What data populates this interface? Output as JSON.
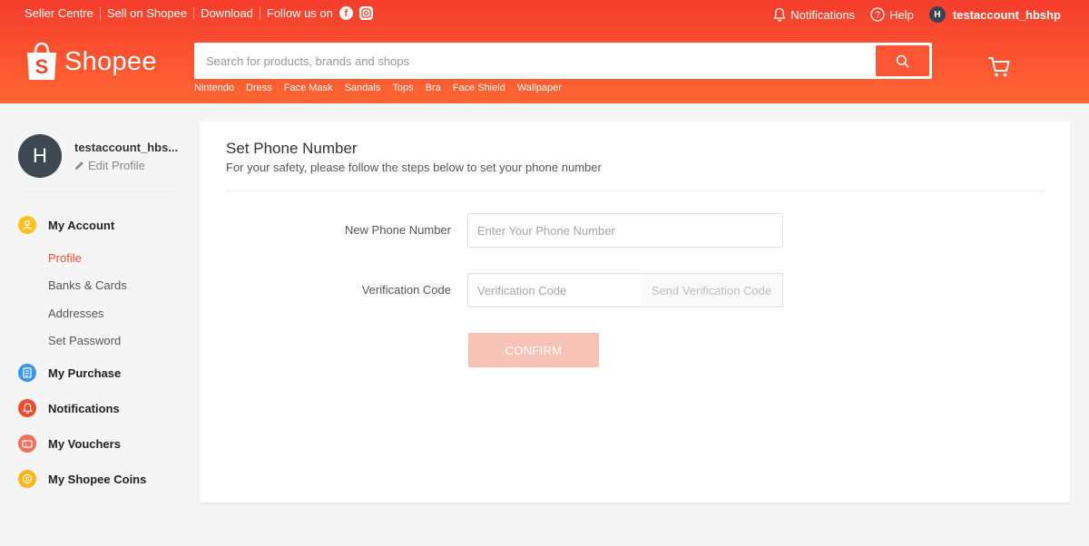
{
  "topbar": {
    "links": [
      "Seller Centre",
      "Sell on Shopee",
      "Download"
    ],
    "follow_label": "Follow us on",
    "notifications_label": "Notifications",
    "help_label": "Help",
    "avatar_initial": "H",
    "username": "testaccount_hbshp"
  },
  "brand": {
    "logo_text": "Shopee",
    "logo_bag_letter": "S",
    "color": "#ee4d2d"
  },
  "search": {
    "placeholder": "Search for products, brands and shops",
    "suggestions": [
      "Nintendo",
      "Dress",
      "Face Mask",
      "Sandals",
      "Tops",
      "Bra",
      "Face Shield",
      "Wallpaper"
    ]
  },
  "sidebar": {
    "avatar_initial": "H",
    "username": "testaccount_hbs...",
    "edit_profile": "Edit Profile",
    "my_account": "My Account",
    "account_sub": [
      {
        "label": "Profile",
        "active": true
      },
      {
        "label": "Banks & Cards",
        "active": false
      },
      {
        "label": "Addresses",
        "active": false
      },
      {
        "label": "Set Password",
        "active": false
      }
    ],
    "my_purchase": "My Purchase",
    "notifications": "Notifications",
    "my_vouchers": "My Vouchers",
    "my_shopee_coins": "My Shopee Coins"
  },
  "main": {
    "title": "Set Phone Number",
    "subtitle": "For your safety, please follow the steps below to set your phone number",
    "phone_label": "New Phone Number",
    "phone_placeholder": "Enter Your Phone Number",
    "code_label": "Verification Code",
    "code_placeholder": "Verification Code",
    "send_code": "Send Verification Code",
    "confirm": "CONFIRM"
  }
}
